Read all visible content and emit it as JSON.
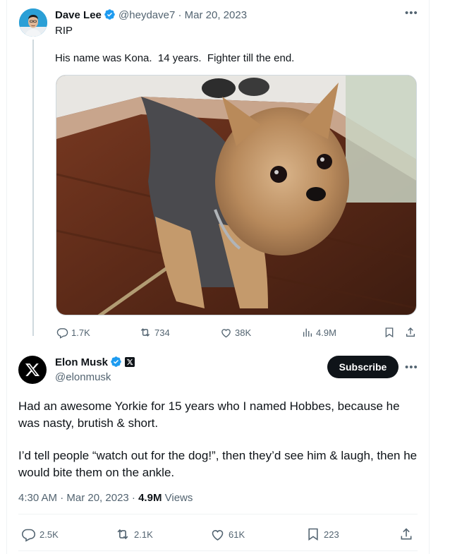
{
  "parent_tweet": {
    "display_name": "Dave Lee",
    "handle": "@heydave7",
    "date": "· Mar 20, 2023",
    "text_line1": "RIP",
    "text_line2": "His name was Kona.  14 years.  Fighter till the end.",
    "image_subject": "Yorkshire terrier dog on wooden floor",
    "metrics": {
      "replies": "1.7K",
      "reposts": "734",
      "likes": "38K",
      "views": "4.9M"
    }
  },
  "main_tweet": {
    "display_name": "Elon Musk",
    "handle": "@elonmusk",
    "subscribe_label": "Subscribe",
    "paragraph1": "Had an awesome Yorkie for 15 years who I named Hobbes, because he was nasty, brutish & short.",
    "paragraph2": "I’d tell people “watch out for the dog!”, then they’d see him & laugh, then he would bite them on the ankle.",
    "timestamp": "4:30 AM · Mar 20, 2023 ·",
    "views_count": "4.9M",
    "views_label": "Views",
    "metrics": {
      "replies": "2.5K",
      "reposts": "2.1K",
      "likes": "61K",
      "bookmarks": "223"
    }
  },
  "colors": {
    "verified_blue": "#1d9bf0",
    "text_primary": "#0f1419",
    "text_secondary": "#536471",
    "button_dark": "#0f1419"
  },
  "icons": [
    "more-icon",
    "verified-icon",
    "reply-icon",
    "repost-icon",
    "like-icon",
    "views-icon",
    "bookmark-icon",
    "share-icon",
    "x-logo-icon"
  ]
}
